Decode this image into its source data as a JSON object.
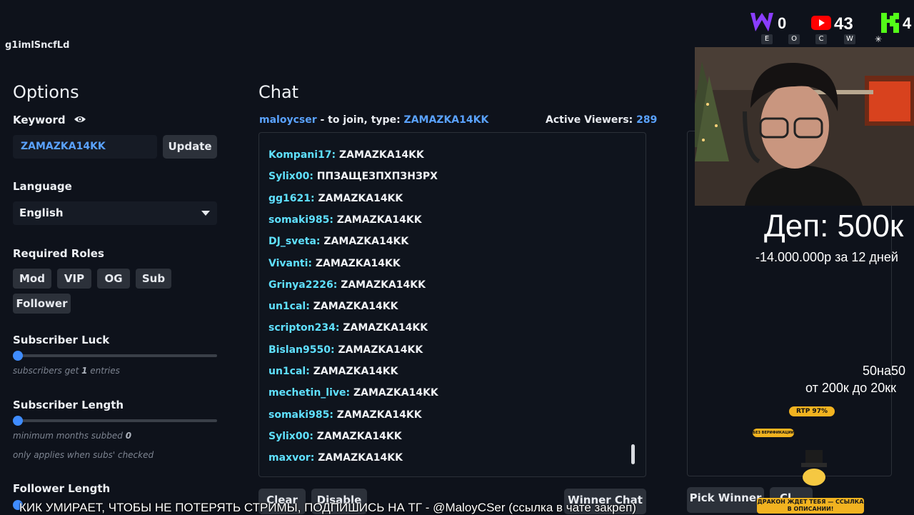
{
  "app_id": "g1imlSncfLd",
  "options": {
    "title": "Options",
    "keyword_label": "Keyword",
    "keyword_value": "ZAMAZKA14KK",
    "update_label": "Update",
    "language_label": "Language",
    "language_value": "English",
    "roles_label": "Required Roles",
    "roles": [
      "Mod",
      "VIP",
      "OG",
      "Sub",
      "Follower"
    ],
    "sub_luck_label": "Subscriber Luck",
    "sub_luck_hint_pre": "subscribers get ",
    "sub_luck_hint_num": "1",
    "sub_luck_hint_post": " entries",
    "sub_length_label": "Subscriber Length",
    "sub_length_hint_pre": "minimum months subbed ",
    "sub_length_hint_num": "0",
    "sub_length_hint2": "only applies when subs' checked",
    "follower_length_label": "Follower Length"
  },
  "chat": {
    "title": "Chat",
    "channel": "maloycser",
    "join_text": " - to join, type: ",
    "join_keyword": "ZAMAZKA14KK",
    "viewers_label": "Active Viewers:",
    "viewers_count": "289",
    "messages": [
      {
        "user": "Kompani17:",
        "text": "ZAMAZKA14KK"
      },
      {
        "user": "Sylix00:",
        "text": "ППЗАЩЕЗПХПЗНЗРХ"
      },
      {
        "user": "gg1621:",
        "text": "ZAMAZKA14KK"
      },
      {
        "user": "somaki985:",
        "text": "ZAMAZKA14KK"
      },
      {
        "user": "DJ_sveta:",
        "text": "ZAMAZKA14KK"
      },
      {
        "user": "Vivanti:",
        "text": "ZAMAZKA14KK"
      },
      {
        "user": "Grinya2226:",
        "text": "ZAMAZKA14KK"
      },
      {
        "user": "un1cal:",
        "text": "ZAMAZKA14KK"
      },
      {
        "user": "scripton234:",
        "text": "ZAMAZKA14KK"
      },
      {
        "user": "Bislan9550:",
        "text": "ZAMAZKA14KK"
      },
      {
        "user": "un1cal:",
        "text": "ZAMAZKA14KK"
      },
      {
        "user": "mechetin_live:",
        "text": "ZAMAZKA14KK"
      },
      {
        "user": "somaki985:",
        "text": "ZAMAZKA14KK"
      },
      {
        "user": "Sylix00:",
        "text": "ZAMAZKA14KK"
      },
      {
        "user": "maxvor:",
        "text": "ZAMAZKA14KK"
      }
    ],
    "clear_label": "Clear",
    "disable_label": "Disable",
    "winner_chat_label": "Winner Chat"
  },
  "winner": {
    "pick_label": "Pick Winner",
    "clear_partial": "Cl"
  },
  "overlay": {
    "counter_w": "0",
    "counter_yt": "43",
    "counter_k": "4",
    "letters": [
      "E",
      "O",
      "C",
      "W"
    ],
    "dep_text": "Деп: 500к",
    "dep_sub": "-14.000.000р за 12 дней",
    "line1": "50на50",
    "line2": "от 200к до 20кк",
    "rtp": "RTP 97%",
    "verif": "БЕЗ ВЕРИФИКАЦИИ",
    "dragon": "ДРАКОН ЖДЕТ ТЕБЯ — ССЫЛКА В ОПИСАНИИ!",
    "subtitle": "КИК УМИРАЕТ, ЧТОБЫ НЕ ПОТЕРЯТЬ СТРИМЫ, ПОДПИШИСЬ НА ТГ - @MaloyCSer (ссылка в чате закреп)"
  },
  "colors": {
    "accent": "#3f8cff",
    "username": "#5fe0ff",
    "bg": "#0e121b"
  }
}
